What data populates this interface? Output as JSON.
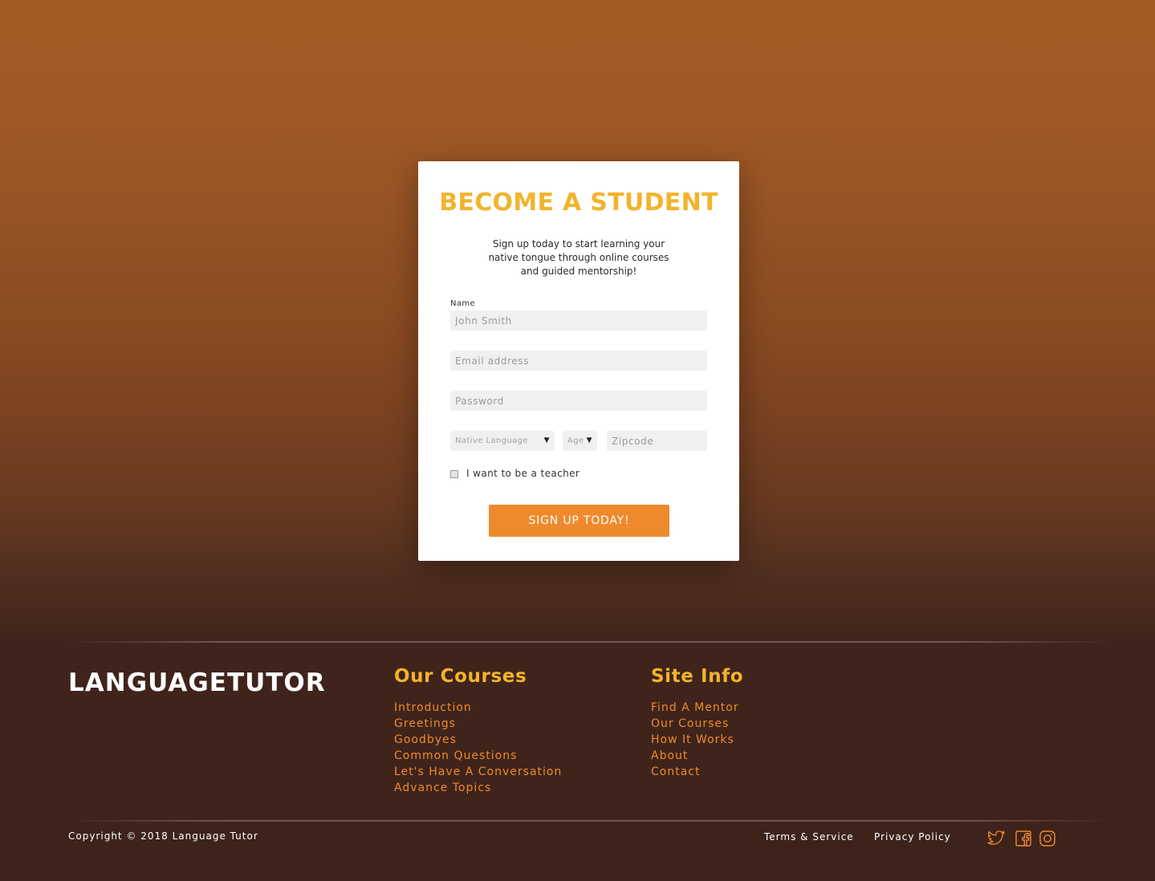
{
  "signup": {
    "title": "BECOME A STUDENT",
    "subtitle": "Sign up today to start learning your native tongue through online courses and guided mentorship!",
    "name_label": "Name",
    "name_placeholder": "John Smith",
    "email_placeholder": "Email address",
    "password_placeholder": "Password",
    "native_language_placeholder": "Native Language",
    "age_placeholder": "Age",
    "zipcode_placeholder": "Zipcode",
    "teacher_checkbox_label": "I want to be a teacher",
    "teacher_checked": false,
    "submit_label": "SIGN UP TODAY!"
  },
  "footer": {
    "brand": "LANGUAGETUTOR",
    "courses_title": "Our Courses",
    "courses": [
      "Introduction",
      "Greetings",
      "Goodbyes",
      "Common Questions",
      "Let's Have A Conversation",
      "Advance Topics"
    ],
    "siteinfo_title": "Site Info",
    "siteinfo": [
      "Find A Mentor",
      "Our Courses",
      "How It Works",
      "About",
      "Contact"
    ],
    "copyright": "Copyright © 2018 Language Tutor",
    "terms": "Terms & Service",
    "privacy": "Privacy Policy",
    "social_icons": [
      "twitter-icon",
      "facebook-icon",
      "instagram-icon"
    ]
  },
  "colors": {
    "accent_yellow": "#f2b42d",
    "accent_orange": "#ef8a2c",
    "footer_bg": "#3e231b"
  }
}
